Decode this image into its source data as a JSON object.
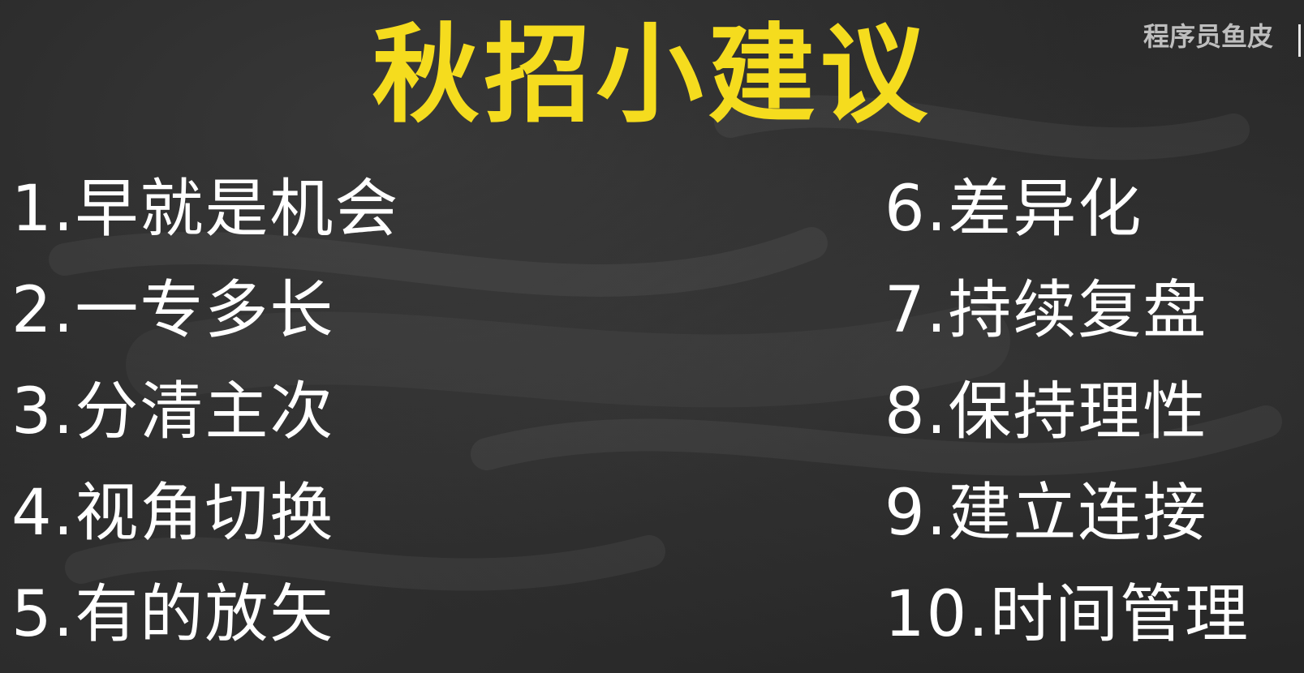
{
  "title": "秋招小建议",
  "watermark": "程序员鱼皮",
  "left_items": [
    "1.早就是机会",
    "2.一专多长",
    "3.分清主次",
    "4.视角切换",
    "5.有的放矢"
  ],
  "right_items": [
    "6.差异化",
    "7.持续复盘",
    "8.保持理性",
    "9.建立连接",
    "10.时间管理"
  ],
  "colors": {
    "background": "#262626",
    "title": "#f5dc1e",
    "text": "#ffffff",
    "watermark": "#d8d8d8"
  }
}
